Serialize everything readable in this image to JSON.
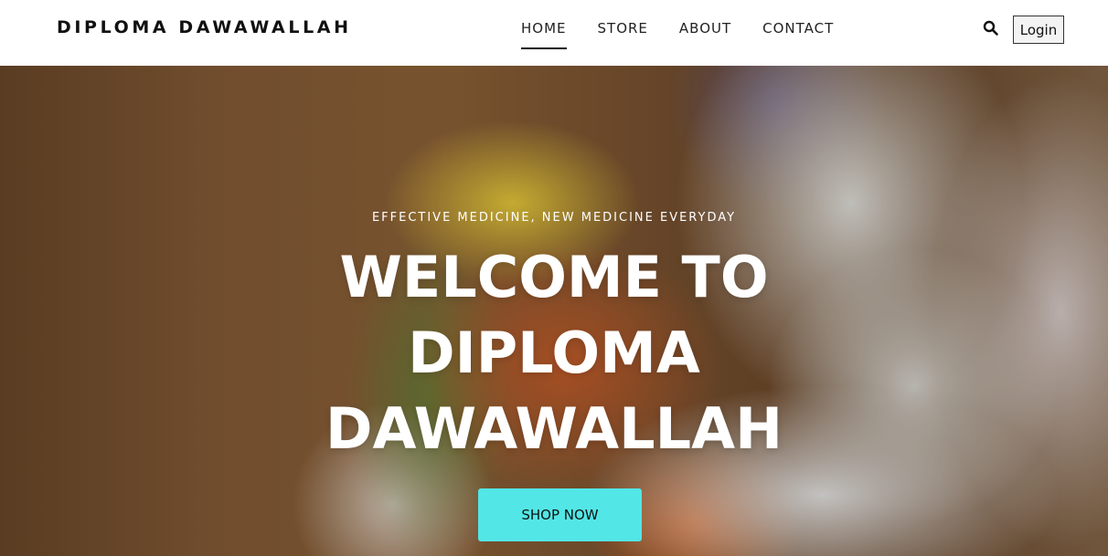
{
  "header": {
    "brand": "DIPLOMA DAWAWALLAH",
    "nav": [
      {
        "label": "HOME",
        "active": true
      },
      {
        "label": "STORE",
        "active": false
      },
      {
        "label": "ABOUT",
        "active": false
      },
      {
        "label": "CONTACT",
        "active": false
      }
    ],
    "search_icon": "search-icon",
    "login_label": "Login"
  },
  "hero": {
    "tagline": "EFFECTIVE MEDICINE, NEW MEDICINE EVERYDAY",
    "title": "WELCOME TO DIPLOMA DAWAWALLAH",
    "cta_label": "SHOP NOW",
    "cta_color": "#52e6e6"
  }
}
